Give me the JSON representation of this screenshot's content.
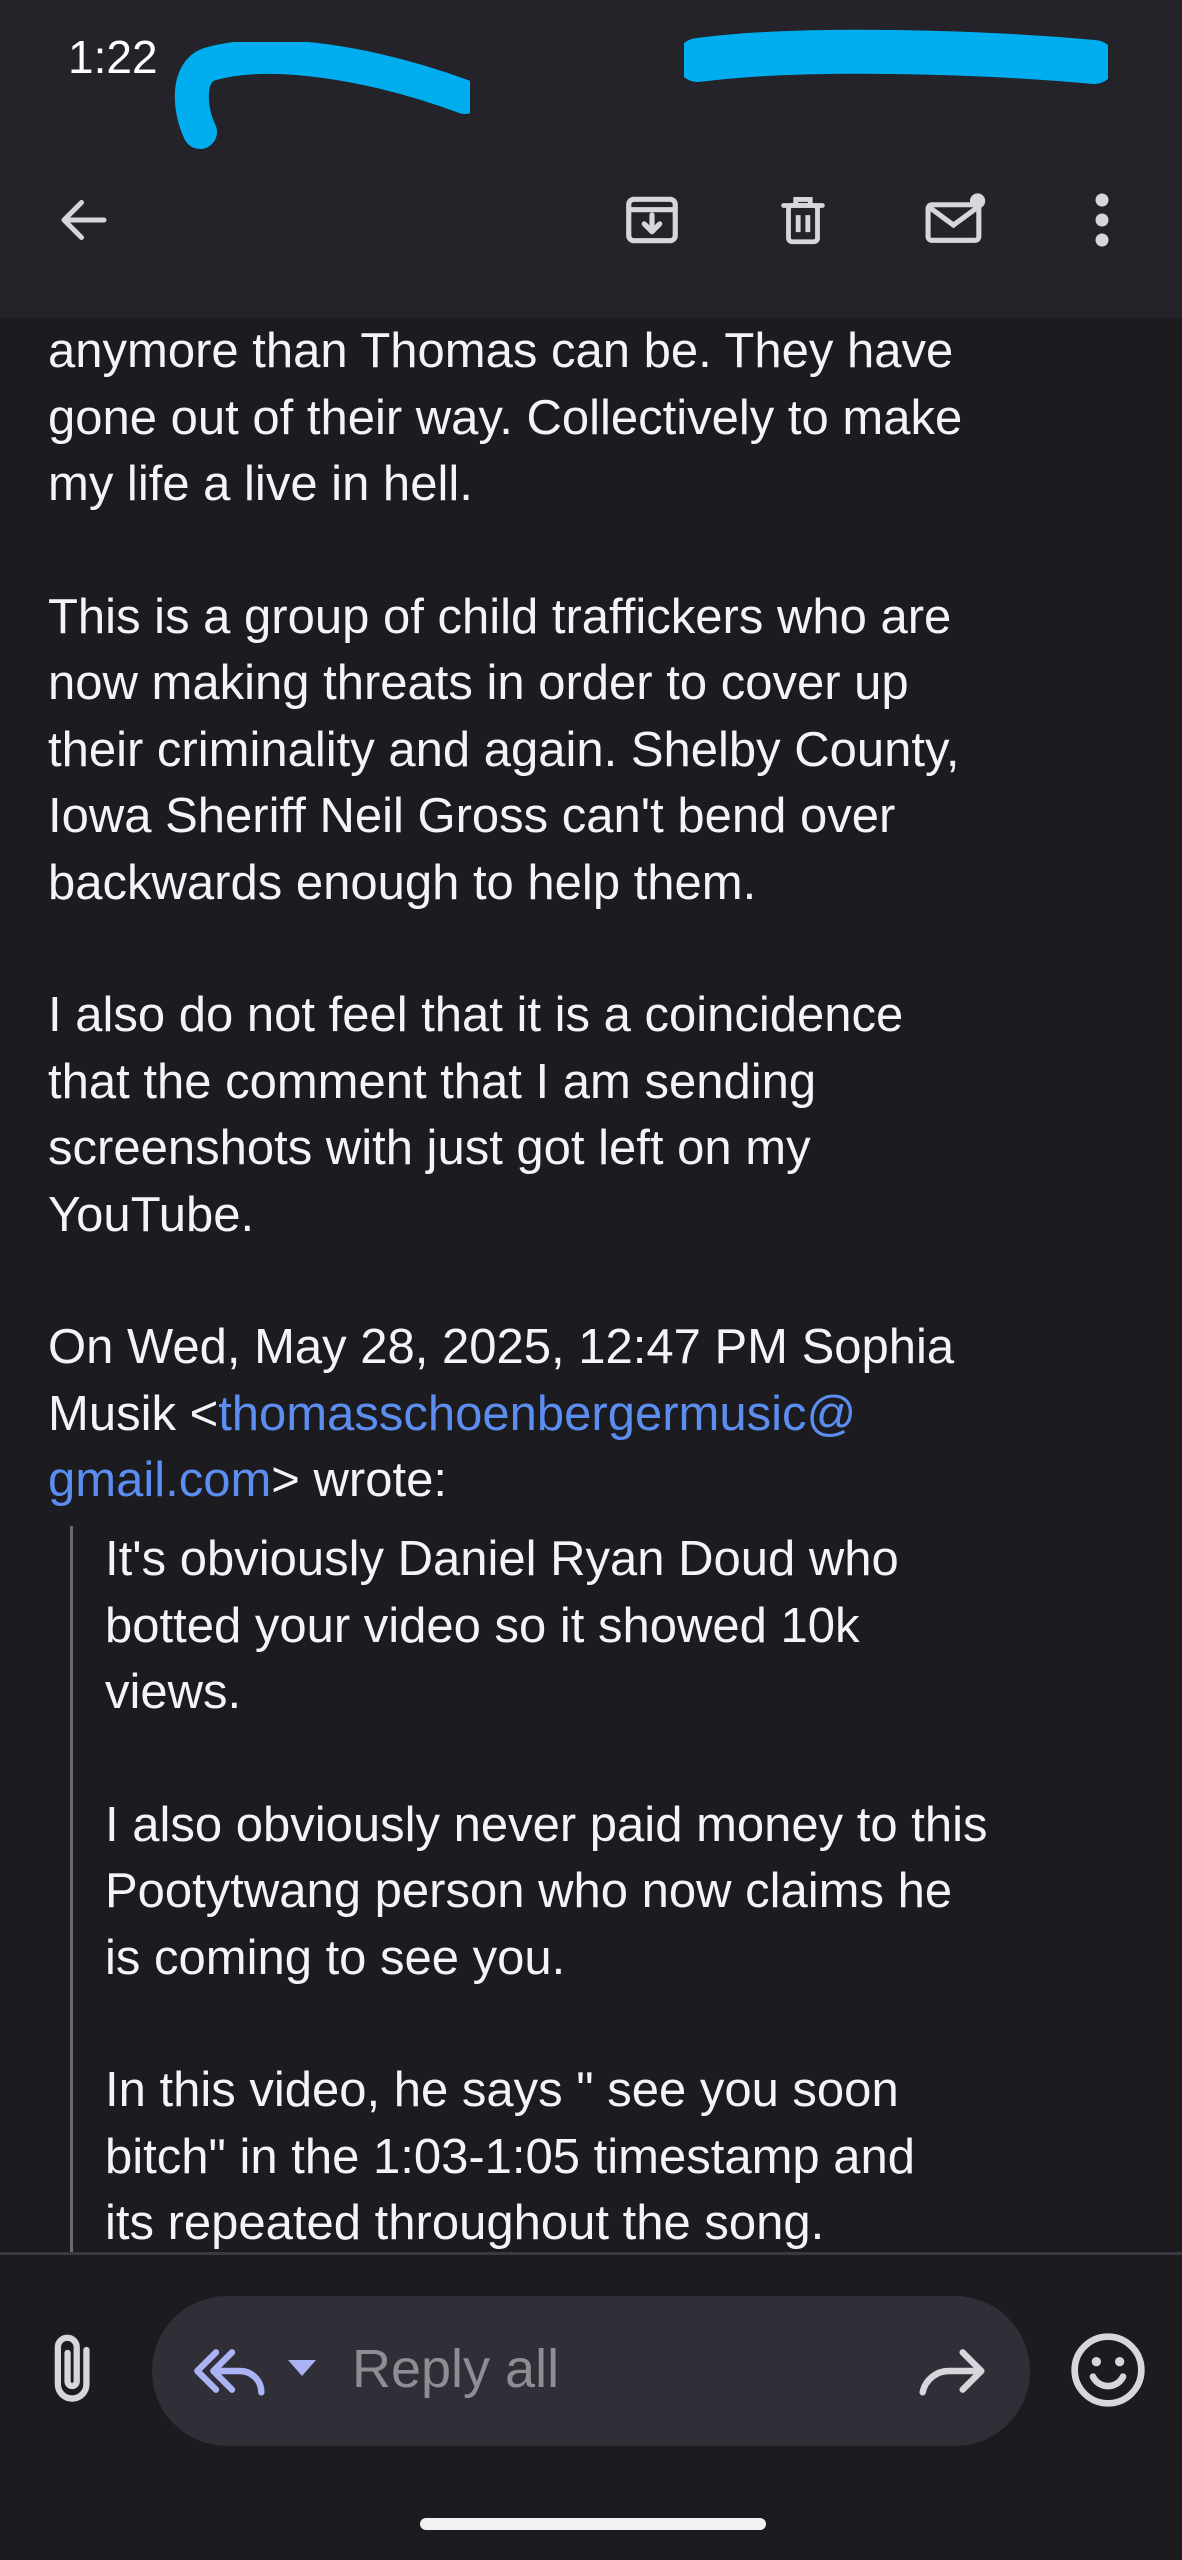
{
  "status_bar": {
    "time": "1:22"
  },
  "toolbar": {
    "back_icon": "arrow-left-icon",
    "archive_icon": "archive-icon",
    "delete_icon": "trash-icon",
    "mark_unread_icon": "mail-unread-icon",
    "more_icon": "more-vert-icon"
  },
  "email": {
    "partial_line": "anymore than Thomas can be. They have",
    "paragraphs": [
      "anymore than Thomas can be. They have\ngone out of their way. Collectively to make\nmy life a live in hell.",
      "This is a group of child traffickers who are\nnow making threats in order to cover up\ntheir criminality and again. Shelby County,\nIowa Sheriff Neil Gross can't bend over\nbackwards enough to help them.",
      "I also do not feel that it is a coincidence\nthat the comment that I am sending\nscreenshots with just got left on my\nYouTube."
    ],
    "attribution_prefix": "On Wed, May 28, 2025, 12:47 PM Sophia\nMusik <",
    "attribution_email": "thomasschoenbergermusic@\ngmail.com",
    "attribution_suffix": "> wrote:",
    "quoted_paragraphs": [
      "It's obviously Daniel Ryan Doud who\nbotted your video so it showed 10k\nviews.",
      "I also obviously never paid money to this\nPootytwang person who now claims he\nis coming to see you.",
      "In this video, he says \" see you soon\nbitch\" in the 1:03-1:05 timestamp and\nits repeated throughout the song."
    ]
  },
  "compose": {
    "reply_placeholder": "Reply all",
    "attach_icon": "paperclip-icon",
    "reply_all_icon": "reply-all-icon",
    "forward_icon": "forward-icon",
    "emoji_icon": "emoji-icon"
  },
  "colors": {
    "background": "#1c1b20",
    "toolbar": "#242329",
    "link": "#5b8ef0",
    "redaction": "#00aeef"
  }
}
